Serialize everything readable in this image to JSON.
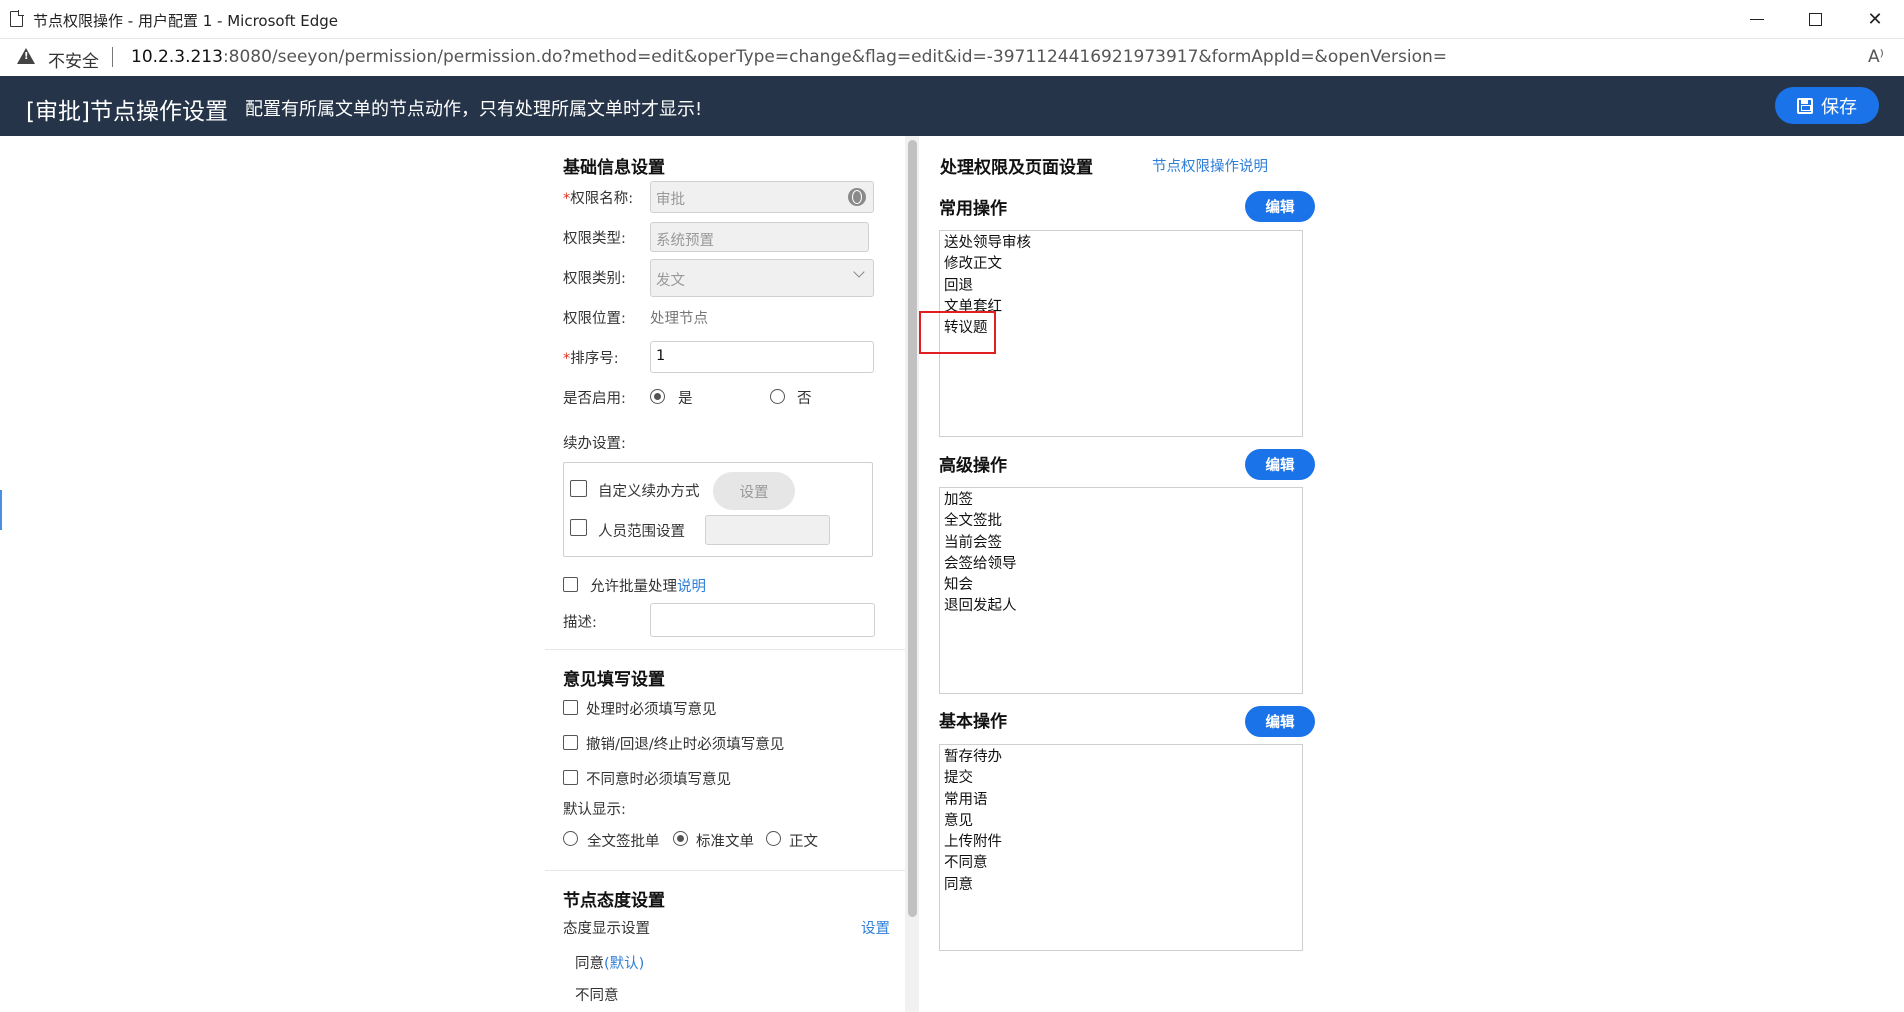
{
  "window": {
    "title": "节点权限操作 - 用户配置 1 - Microsoft Edge"
  },
  "address_bar": {
    "security_label": "不安全",
    "url_host": "10.2.3.213",
    "url_rest": ":8080/seeyon/permission/permission.do?method=edit&operType=change&flag=edit&id=-3971124416921973917&formAppId=&openVersion=",
    "read_aloud": "A⁾"
  },
  "header": {
    "title": "[审批]节点操作设置",
    "description": "配置有所属文单的节点动作，只有处理所属文单时才显示!",
    "save_label": "保存"
  },
  "basic_info": {
    "section_title": "基础信息设置",
    "required_mark": "*",
    "name_label": "权限名称:",
    "name_value": "审批",
    "type_label": "权限类型:",
    "type_value": "系统预置",
    "category_label": "权限类别:",
    "category_value": "发文",
    "position_label": "权限位置:",
    "position_value": "处理节点",
    "order_label": "排序号:",
    "order_value": "1",
    "enabled_label": "是否启用:",
    "enabled_yes": "是",
    "enabled_no": "否",
    "continue_label": "续办设置:",
    "custom_continue_label": "自定义续办方式",
    "settings_button": "设置",
    "person_range_label": "人员范围设置",
    "batch_label": "允许批量处理",
    "batch_link": "说明",
    "desc_label": "描述:"
  },
  "opinion": {
    "section_title": "意见填写设置",
    "must_on_process": "处理时必须填写意见",
    "must_on_revoke": "撤销/回退/终止时必须填写意见",
    "must_on_disagree": "不同意时必须填写意见",
    "default_display_label": "默认显示:",
    "options": [
      "全文签批单",
      "标准文单",
      "正文"
    ],
    "selected": "标准文单"
  },
  "attitude": {
    "section_title": "节点态度设置",
    "display_label": "态度显示设置",
    "settings_link": "设置",
    "agree": "同意",
    "agree_default": "(默认)",
    "disagree": "不同意"
  },
  "right_panel": {
    "title": "处理权限及页面设置",
    "help_link": "节点权限操作说明",
    "edit_label": "编辑",
    "common_ops_title": "常用操作",
    "common_ops": [
      "送处领导审核",
      "修改正文",
      "回退",
      "文单套红",
      "转议题"
    ],
    "advanced_ops_title": "高级操作",
    "advanced_ops": [
      "加签",
      "全文签批",
      "当前会签",
      "会签给领导",
      "知会",
      "退回发起人"
    ],
    "basic_ops_title": "基本操作",
    "basic_ops": [
      "暂存待办",
      "提交",
      "常用语",
      "意见",
      "上传附件",
      "不同意",
      "同意"
    ]
  },
  "colors": {
    "header_bg": "#263449",
    "accent": "#1a73e8",
    "link": "#2f7fd8",
    "highlight": "#e02020"
  }
}
